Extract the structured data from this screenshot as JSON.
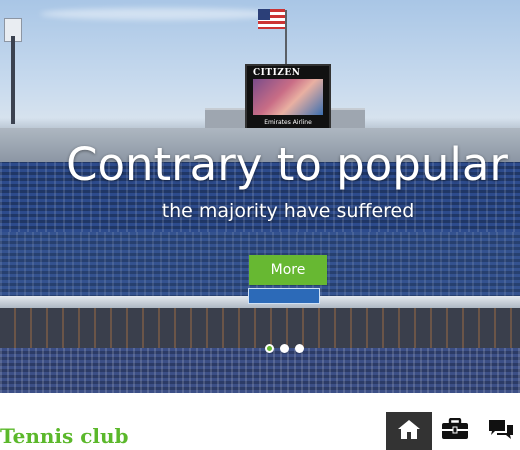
{
  "hero": {
    "scoreboard_brand": "CITIZEN",
    "scoreboard_sponsor": "Emirates Airline",
    "title": "Contrary to popular",
    "subtitle": "the majority have suffered",
    "button_label": "More",
    "slide_count": 3,
    "active_slide": 1
  },
  "header": {
    "logo_text": "Tennis club"
  },
  "nav": {
    "items": [
      {
        "name": "home",
        "icon": "home-icon",
        "active": true
      },
      {
        "name": "portfolio",
        "icon": "briefcase-icon",
        "active": false
      },
      {
        "name": "contact",
        "icon": "chat-icon",
        "active": false
      }
    ]
  },
  "colors": {
    "accent": "#67b832",
    "logo": "#5bb82b",
    "nav_active_bg": "#333333"
  }
}
